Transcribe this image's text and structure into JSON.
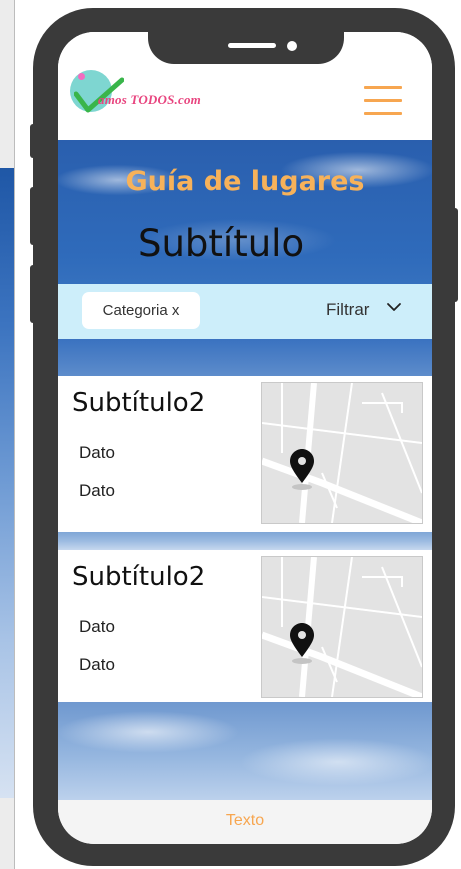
{
  "brand": {
    "logo_text": "amos TODOS.com",
    "accent": "#f7a650"
  },
  "hero": {
    "title": "Guía de lugares",
    "subtitle": "Subtítulo"
  },
  "filter": {
    "chip_label": "Categoria x",
    "filter_label": "Filtrar"
  },
  "cards": [
    {
      "title": "Subtítulo2",
      "data": [
        "Dato",
        "Dato"
      ]
    },
    {
      "title": "Subtítulo2",
      "data": [
        "Dato",
        "Dato"
      ]
    }
  ],
  "footer": {
    "text": "Texto"
  }
}
